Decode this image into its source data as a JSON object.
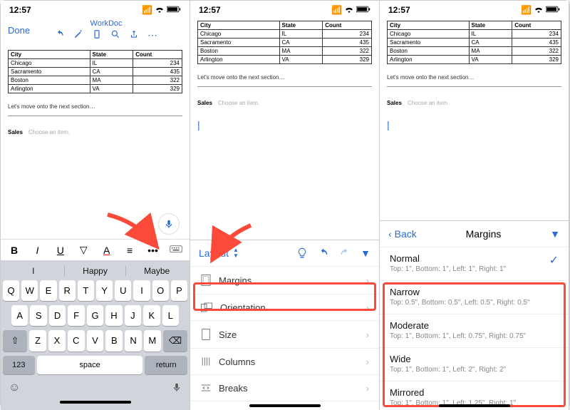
{
  "status": {
    "time": "12:57"
  },
  "doc": {
    "title": "WorkDoc",
    "done": "Done",
    "table": {
      "headers": [
        "City",
        "State",
        "Count"
      ],
      "rows": [
        [
          "Chicago",
          "IL",
          "234"
        ],
        [
          "Sacramento",
          "CA",
          "435"
        ],
        [
          "Boston",
          "MA",
          "322"
        ],
        [
          "Arlington",
          "VA",
          "329"
        ]
      ]
    },
    "section_text": "Let's move onto the next section…",
    "sales_label": "Sales",
    "choose_label": "Choose an item."
  },
  "keyboard": {
    "suggestions": [
      "I",
      "Happy",
      "Maybe"
    ],
    "rows": [
      [
        "Q",
        "W",
        "E",
        "R",
        "T",
        "Y",
        "U",
        "I",
        "O",
        "P"
      ],
      [
        "A",
        "S",
        "D",
        "F",
        "G",
        "H",
        "J",
        "K",
        "L"
      ],
      [
        "Z",
        "X",
        "C",
        "V",
        "B",
        "N",
        "M"
      ]
    ],
    "shift": "⇧",
    "del": "⌫",
    "numkey": "123",
    "space": "space",
    "return": "return"
  },
  "layout": {
    "title": "Layout",
    "updown": "▲▼",
    "items": [
      {
        "icon": "margins",
        "label": "Margins"
      },
      {
        "icon": "orientation",
        "label": "Orientation"
      },
      {
        "icon": "size",
        "label": "Size"
      },
      {
        "icon": "columns",
        "label": "Columns"
      },
      {
        "icon": "breaks",
        "label": "Breaks"
      }
    ]
  },
  "margins": {
    "back": "Back",
    "title": "Margins",
    "options": [
      {
        "name": "Normal",
        "desc": "Top: 1\", Bottom: 1\", Left: 1\", Right: 1\"",
        "selected": true
      },
      {
        "name": "Narrow",
        "desc": "Top: 0.5\", Bottom: 0.5\", Left: 0.5\", Right: 0.5\""
      },
      {
        "name": "Moderate",
        "desc": "Top: 1\", Bottom: 1\", Left: 0.75\", Right: 0.75\""
      },
      {
        "name": "Wide",
        "desc": "Top: 1\", Bottom: 1\", Left: 2\", Right: 2\""
      },
      {
        "name": "Mirrored",
        "desc": "Top: 1\", Bottom: 1\", Left: 1.25\", Right: 1\""
      }
    ]
  }
}
